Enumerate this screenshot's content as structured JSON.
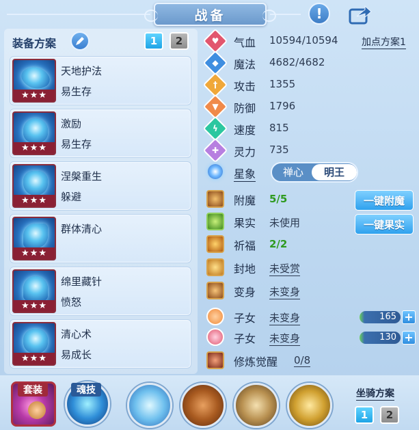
{
  "header": {
    "title": "战备",
    "info_icon": "exclamation-icon",
    "share_icon": "share-icon"
  },
  "left": {
    "title": "装备方案",
    "plan_buttons": [
      "1",
      "2"
    ],
    "cards": [
      {
        "name": "天地护法",
        "sub": "易生存",
        "stars": "★★★"
      },
      {
        "name": "激励",
        "sub": "易生存",
        "stars": "★★★"
      },
      {
        "name": "涅槃重生",
        "sub": "躲避",
        "stars": "★★★"
      },
      {
        "name": "群体清心",
        "sub": "",
        "stars": "★★★"
      },
      {
        "name": "绵里藏针",
        "sub": "愤怒",
        "stars": "★★★"
      },
      {
        "name": "清心术",
        "sub": "易成长",
        "stars": "★★★"
      }
    ]
  },
  "stats": {
    "add_plan": "加点方案1",
    "rows": [
      {
        "label": "气血",
        "value": "10594/10594",
        "color": "#e2566e",
        "glyph": "♥"
      },
      {
        "label": "魔法",
        "value": "4682/4682",
        "color": "#3f8ee0",
        "glyph": "◆"
      },
      {
        "label": "攻击",
        "value": "1355",
        "color": "#f0a83a",
        "glyph": "†"
      },
      {
        "label": "防御",
        "value": "1796",
        "color": "#f08a4a",
        "glyph": "▼"
      },
      {
        "label": "速度",
        "value": "815",
        "color": "#2cc7a0",
        "glyph": "ϟ"
      },
      {
        "label": "灵力",
        "value": "735",
        "color": "#b77fe0",
        "glyph": "✚"
      }
    ],
    "star": {
      "label": "星象",
      "options": [
        "禅心",
        "明王"
      ]
    }
  },
  "extras": [
    {
      "label": "附魔",
      "value": "5/5",
      "style": "green"
    },
    {
      "label": "果实",
      "value": "未使用",
      "style": "plain"
    },
    {
      "label": "祈福",
      "value": "2/2",
      "style": "green"
    },
    {
      "label": "封地",
      "value": "未受赏",
      "style": "link"
    },
    {
      "label": "变身",
      "value": "未变身",
      "style": "link"
    },
    {
      "label": "子女",
      "value": "未变身",
      "style": "link"
    },
    {
      "label": "子女",
      "value": "未变身",
      "style": "link"
    },
    {
      "label": "修炼觉醒",
      "value": "0/8",
      "style": "link"
    }
  ],
  "buttons": {
    "one_key_enchant": "一键附魔",
    "one_key_fruit": "一键果实"
  },
  "child_values": [
    "165",
    "130"
  ],
  "bottom": {
    "set_label": "套装",
    "soul_label": "魂技",
    "mount_title": "坐骑方案",
    "mount_buttons": [
      "1",
      "2"
    ]
  }
}
